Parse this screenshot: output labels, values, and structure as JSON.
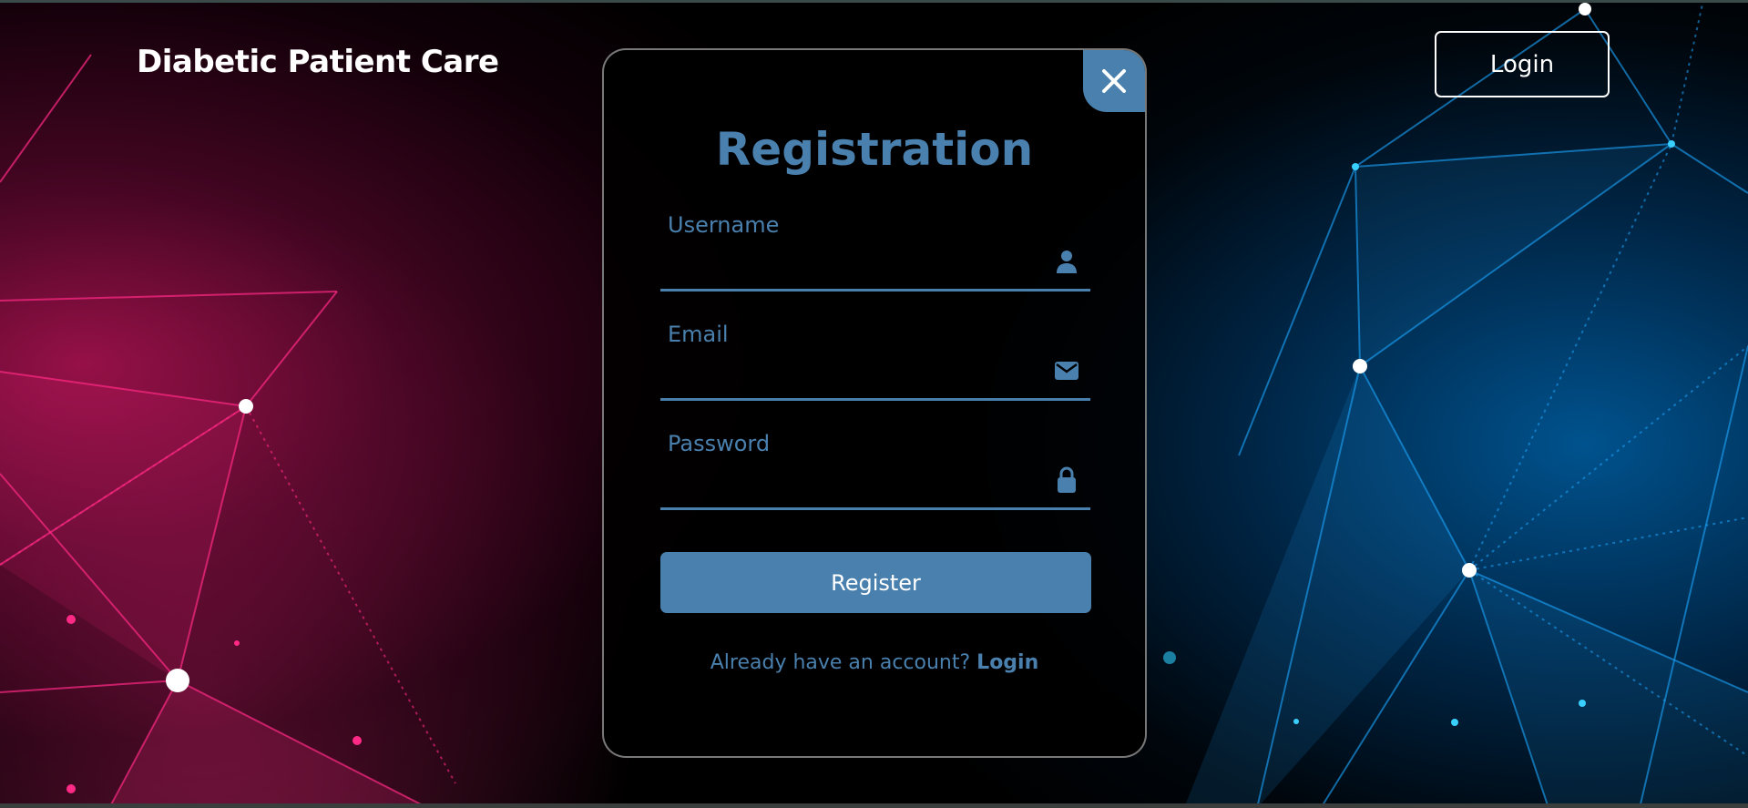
{
  "header": {
    "brand": "Diabetic Patient Care",
    "login_label": "Login"
  },
  "modal": {
    "title": "Registration",
    "fields": [
      {
        "label": "Username",
        "icon": "user-icon",
        "value": ""
      },
      {
        "label": "Email",
        "icon": "envelope-icon",
        "value": ""
      },
      {
        "label": "Password",
        "icon": "lock-icon",
        "value": ""
      }
    ],
    "register_label": "Register",
    "account_prompt": "Already have an account?",
    "account_link": "Login",
    "close_icon": "close-icon"
  },
  "colors": {
    "accent": "#4a80ad",
    "text_light": "#ffffff",
    "background": "#000000",
    "pink_glow": "#e0186e",
    "blue_glow": "#0a7fd0"
  }
}
